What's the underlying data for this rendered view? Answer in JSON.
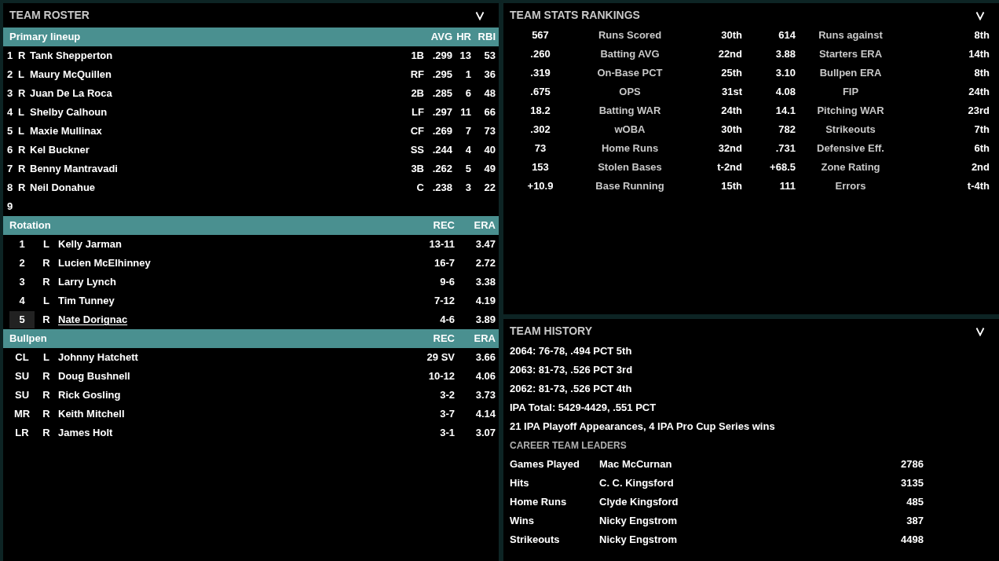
{
  "roster": {
    "title": "TEAM ROSTER",
    "sections": [
      {
        "kind": "lineup",
        "title": "Primary lineup",
        "columns": [
          "AVG",
          "HR",
          "RBI"
        ],
        "rows": [
          {
            "order": "1",
            "hand": "R",
            "name": "Tank Shepperton",
            "pos": "1B",
            "avg": ".299",
            "hr": "13",
            "rbi": "53"
          },
          {
            "order": "2",
            "hand": "L",
            "name": "Maury McQuillen",
            "pos": "RF",
            "avg": ".295",
            "hr": "1",
            "rbi": "36"
          },
          {
            "order": "3",
            "hand": "R",
            "name": "Juan De La Roca",
            "pos": "2B",
            "avg": ".285",
            "hr": "6",
            "rbi": "48"
          },
          {
            "order": "4",
            "hand": "L",
            "name": "Shelby Calhoun",
            "pos": "LF",
            "avg": ".297",
            "hr": "11",
            "rbi": "66"
          },
          {
            "order": "5",
            "hand": "L",
            "name": "Maxie Mullinax",
            "pos": "CF",
            "avg": ".269",
            "hr": "7",
            "rbi": "73"
          },
          {
            "order": "6",
            "hand": "R",
            "name": "Kel Buckner",
            "pos": "SS",
            "avg": ".244",
            "hr": "4",
            "rbi": "40"
          },
          {
            "order": "7",
            "hand": "R",
            "name": "Benny Mantravadi",
            "pos": "3B",
            "avg": ".262",
            "hr": "5",
            "rbi": "49"
          },
          {
            "order": "8",
            "hand": "R",
            "name": "Neil Donahue",
            "pos": "C",
            "avg": ".238",
            "hr": "3",
            "rbi": "22"
          },
          {
            "order": "9"
          }
        ]
      },
      {
        "kind": "pitching",
        "title": "Rotation",
        "columns": [
          "REC",
          "ERA"
        ],
        "rows": [
          {
            "slot": "1",
            "hand": "L",
            "name": "Kelly Jarman",
            "rec": "13-11",
            "era": "3.47",
            "selected": false
          },
          {
            "slot": "2",
            "hand": "R",
            "name": "Lucien McElhinney",
            "rec": "16-7",
            "era": "2.72",
            "selected": false
          },
          {
            "slot": "3",
            "hand": "R",
            "name": "Larry Lynch",
            "rec": "9-6",
            "era": "3.38",
            "selected": false
          },
          {
            "slot": "4",
            "hand": "L",
            "name": "Tim Tunney",
            "rec": "7-12",
            "era": "4.19",
            "selected": false
          },
          {
            "slot": "5",
            "hand": "R",
            "name": "Nate Dorignac",
            "rec": "4-6",
            "era": "3.89",
            "selected": true
          }
        ]
      },
      {
        "kind": "pitching",
        "title": "Bullpen",
        "columns": [
          "REC",
          "ERA"
        ],
        "rows": [
          {
            "slot": "CL",
            "hand": "L",
            "name": "Johnny Hatchett",
            "rec": "29 SV",
            "era": "3.66",
            "selected": false
          },
          {
            "slot": "SU",
            "hand": "R",
            "name": "Doug Bushnell",
            "rec": "10-12",
            "era": "4.06",
            "selected": false
          },
          {
            "slot": "SU",
            "hand": "R",
            "name": "Rick Gosling",
            "rec": "3-2",
            "era": "3.73",
            "selected": false
          },
          {
            "slot": "MR",
            "hand": "R",
            "name": "Keith Mitchell",
            "rec": "3-7",
            "era": "4.14",
            "selected": false
          },
          {
            "slot": "LR",
            "hand": "R",
            "name": "James Holt",
            "rec": "3-1",
            "era": "3.07",
            "selected": false
          }
        ]
      }
    ]
  },
  "rankings": {
    "title": "TEAM STATS RANKINGS",
    "rows": [
      {
        "value": "567",
        "label": "Runs Scored",
        "rank": "30th",
        "value_2": "614",
        "label_2": "Runs against",
        "rank_2": "8th"
      },
      {
        "value": ".260",
        "label": "Batting AVG",
        "rank": "22nd",
        "value_2": "3.88",
        "label_2": "Starters ERA",
        "rank_2": "14th"
      },
      {
        "value": ".319",
        "label": "On-Base PCT",
        "rank": "25th",
        "value_2": "3.10",
        "label_2": "Bullpen ERA",
        "rank_2": "8th"
      },
      {
        "value": ".675",
        "label": "OPS",
        "rank": "31st",
        "value_2": "4.08",
        "label_2": "FIP",
        "rank_2": "24th"
      },
      {
        "value": "18.2",
        "label": "Batting WAR",
        "rank": "24th",
        "value_2": "14.1",
        "label_2": "Pitching WAR",
        "rank_2": "23rd"
      },
      {
        "value": ".302",
        "label": "wOBA",
        "rank": "30th",
        "value_2": "782",
        "label_2": "Strikeouts",
        "rank_2": "7th"
      },
      {
        "value": "73",
        "label": "Home Runs",
        "rank": "32nd",
        "value_2": ".731",
        "label_2": "Defensive Eff.",
        "rank_2": "6th"
      },
      {
        "value": "153",
        "label": "Stolen Bases",
        "rank": "t-2nd",
        "value_2": "+68.5",
        "label_2": "Zone Rating",
        "rank_2": "2nd"
      },
      {
        "value": "+10.9",
        "label": "Base Running",
        "rank": "15th",
        "value_2": "111",
        "label_2": "Errors",
        "rank_2": "t-4th"
      }
    ]
  },
  "history": {
    "title": "TEAM HISTORY",
    "lines": [
      "2064: 76-78, .494 PCT 5th",
      "2063: 81-73, .526 PCT 3rd",
      "2062: 81-73, .526 PCT 4th",
      "IPA Total: 5429-4429, .551 PCT",
      "21 IPA Playoff Appearances, 4 IPA Pro Cup Series wins"
    ],
    "leaders_title": "CAREER TEAM LEADERS",
    "leaders": [
      {
        "category": "Games Played",
        "name": "Mac McCurnan",
        "value": "2786"
      },
      {
        "category": "Hits",
        "name": "C. C. Kingsford",
        "value": "3135"
      },
      {
        "category": "Home Runs",
        "name": "Clyde Kingsford",
        "value": "485"
      },
      {
        "category": "Wins",
        "name": "Nicky Engstrom",
        "value": "387"
      },
      {
        "category": "Strikeouts",
        "name": "Nicky Engstrom",
        "value": "4498"
      }
    ]
  }
}
